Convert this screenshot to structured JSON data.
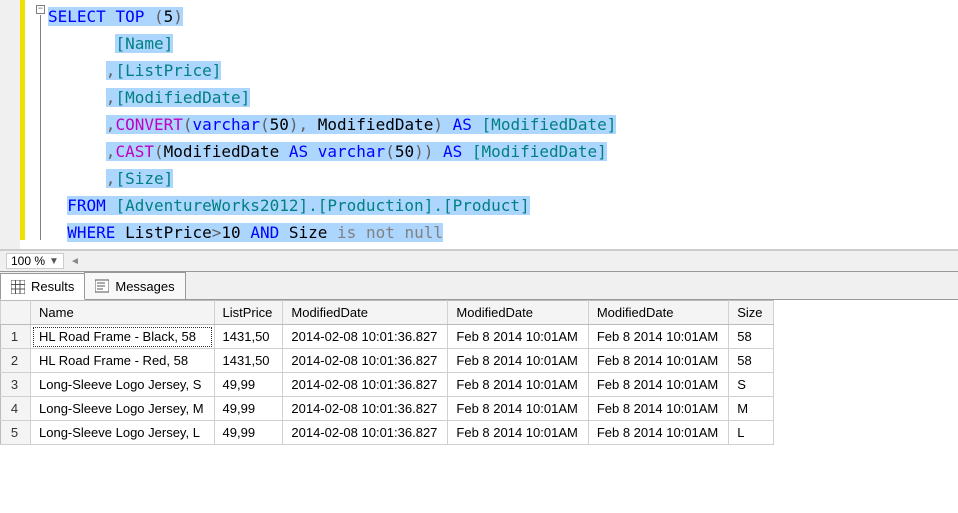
{
  "zoom": {
    "value": "100 %"
  },
  "tabs": {
    "results": "Results",
    "messages": "Messages"
  },
  "sql": {
    "select": "SELECT",
    "top": "TOP",
    "top_n": "5",
    "col_name": "[Name]",
    "col_listprice": "[ListPrice]",
    "col_modifieddate": "[ModifiedDate]",
    "convert": "CONVERT",
    "varchar": "varchar",
    "vlen": "50",
    "modd": "ModifiedDate",
    "as": "AS",
    "alias_md": "[ModifiedDate]",
    "cast": "CAST",
    "col_size": "[Size]",
    "from": "FROM",
    "table": "[AdventureWorks2012].[Production].[Product]",
    "where": "WHERE",
    "where_lp": "ListPrice",
    "gt": ">",
    "ten": "10",
    "and": "AND",
    "size": "Size",
    "isnotnull": "is not null"
  },
  "grid": {
    "headers": [
      "",
      "Name",
      "ListPrice",
      "ModifiedDate",
      "ModifiedDate",
      "ModifiedDate",
      "Size"
    ],
    "rows": [
      [
        "1",
        "HL Road Frame - Black, 58",
        "1431,50",
        "2014-02-08 10:01:36.827",
        "Feb  8 2014 10:01AM",
        "Feb  8 2014 10:01AM",
        "58"
      ],
      [
        "2",
        "HL Road Frame - Red, 58",
        "1431,50",
        "2014-02-08 10:01:36.827",
        "Feb  8 2014 10:01AM",
        "Feb  8 2014 10:01AM",
        "58"
      ],
      [
        "3",
        "Long-Sleeve Logo Jersey, S",
        "49,99",
        "2014-02-08 10:01:36.827",
        "Feb  8 2014 10:01AM",
        "Feb  8 2014 10:01AM",
        "S"
      ],
      [
        "4",
        "Long-Sleeve Logo Jersey, M",
        "49,99",
        "2014-02-08 10:01:36.827",
        "Feb  8 2014 10:01AM",
        "Feb  8 2014 10:01AM",
        "M"
      ],
      [
        "5",
        "Long-Sleeve Logo Jersey, L",
        "49,99",
        "2014-02-08 10:01:36.827",
        "Feb  8 2014 10:01AM",
        "Feb  8 2014 10:01AM",
        "L"
      ]
    ]
  }
}
